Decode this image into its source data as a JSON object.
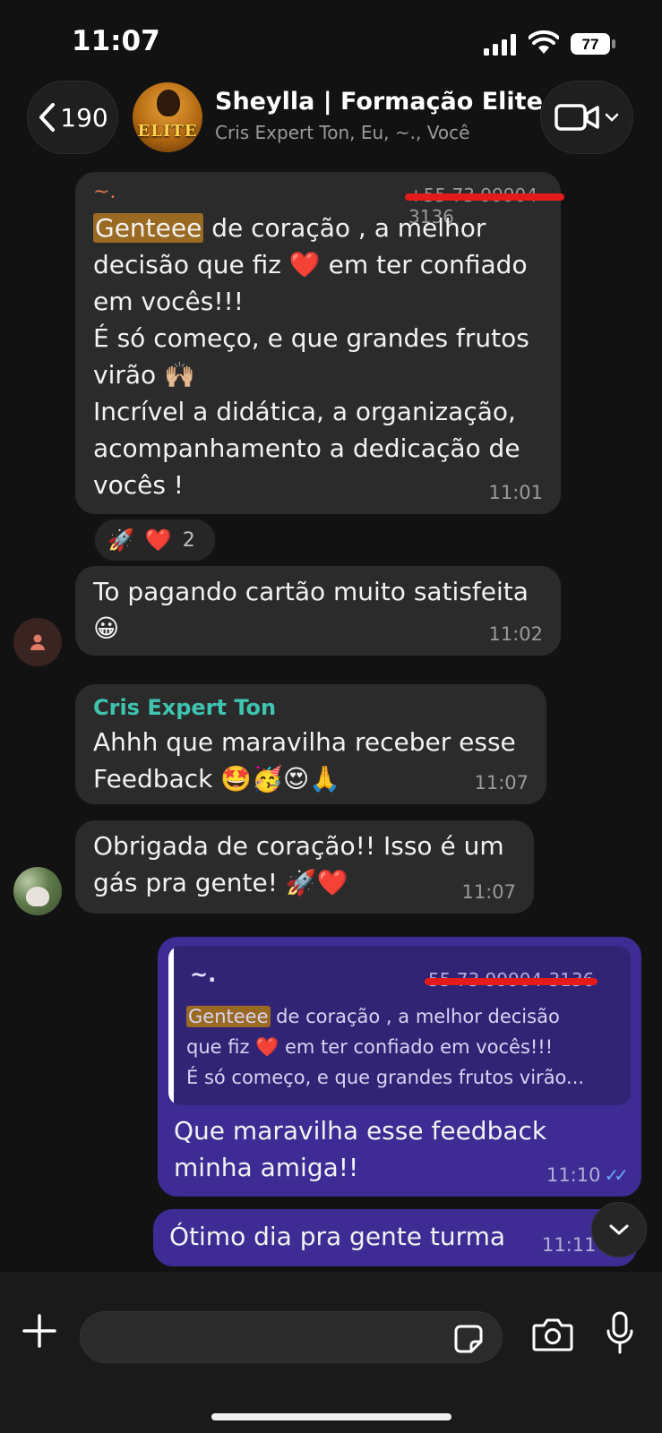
{
  "status_bar": {
    "time": "11:07",
    "battery": "77"
  },
  "header": {
    "back_count": "190",
    "title": "Sheylla | Formação Elite",
    "subtitle": "Cris Expert Ton, Eu, ~., Você",
    "avatar_text": "ELITE"
  },
  "messages": [
    {
      "sender": "~.",
      "sender_phone": "+55 73 99904-3136",
      "highlight": "Genteee",
      "text_lines": [
        " de coração , a melhor",
        "decisão que fiz ❤️ em ter confiado",
        "em vocês!!!",
        "É só começo, e que grandes frutos",
        "virão 🙌🏼",
        "Incrível a didática, a organização,",
        "acompanhamento a dedicação de",
        "vocês !"
      ],
      "time": "11:01",
      "reactions": [
        "🚀",
        "❤️"
      ],
      "reaction_count": "2"
    },
    {
      "text_lines": [
        "To pagando cartão muito satisfeita",
        "😀"
      ],
      "time": "11:02"
    },
    {
      "sender": "Cris Expert Ton",
      "text_lines": [
        "Ahhh que maravilha receber esse",
        "Feedback 🤩🥳😍🙏"
      ],
      "time": "11:07"
    },
    {
      "text_lines": [
        "Obrigada de coração!! Isso é um",
        "gás pra gente! 🚀❤️"
      ],
      "time": "11:07"
    },
    {
      "quote": {
        "sender": "~.",
        "phone": "55 73 99904-3136",
        "highlight": "Genteee",
        "lines": [
          " de coração , a melhor decisão",
          "que fiz ❤️ em ter confiado em vocês!!!",
          "É só começo, e que grandes frutos virão..."
        ]
      },
      "text_lines": [
        "Que maravilha esse feedback",
        "minha amiga!!"
      ],
      "time": "11:10"
    },
    {
      "text_lines": [
        "Ótimo dia pra gente turma"
      ],
      "time": "11:11"
    }
  ],
  "colors": {
    "background": "#121212",
    "incoming_bubble": "#2b2b2b",
    "outgoing_bubble": "#3e2c94",
    "highlight": "#9a6a22",
    "sender_cris": "#3ec4b0",
    "sender_dim": "#e0734e"
  },
  "icons": [
    "chevron-left-icon",
    "video-camera-icon",
    "plus-icon",
    "sticker-icon",
    "camera-icon",
    "microphone-icon",
    "chevron-down-icon",
    "read-ticks-icon"
  ]
}
